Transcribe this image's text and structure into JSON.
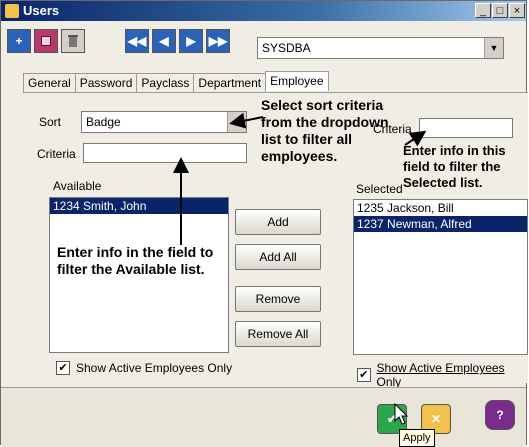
{
  "window": {
    "title": "Users",
    "minimize": "_",
    "maximize": "□",
    "close": "×"
  },
  "toolbar": {
    "database": "SYSDBA",
    "add_icon": "plus-icon",
    "save_icon": "save-icon",
    "delete_icon": "trash-icon",
    "first_icon": "first-record-icon",
    "prev_icon": "previous-record-icon",
    "next_icon": "next-record-icon",
    "last_icon": "last-record-icon"
  },
  "tabs": [
    "General",
    "Password",
    "Payclass",
    "Department",
    "Employee"
  ],
  "form": {
    "sort_label": "Sort",
    "sort_value": "Badge",
    "criteria_label": "Criteria",
    "criteria_value": "",
    "criteria_right_label": "Criteria",
    "available_label": "Available",
    "selected_label": "Selected",
    "available_items": [
      "1234 Smith, John"
    ],
    "selected_items": [
      "1235 Jackson, Bill",
      "1237 Newman, Alfred"
    ]
  },
  "buttons": {
    "add": "Add",
    "add_all": "Add All",
    "remove": "Remove",
    "remove_all": "Remove All",
    "tooltip": "Apply"
  },
  "checkboxes": {
    "left": "Show Active Employees Only",
    "right": "Show Active Employees Only"
  },
  "annotations": {
    "sort": "Select sort criteria from the dropdown list to filter all employees.",
    "available": "Enter info in the field to filter the Available list.",
    "selected": "Enter info in this field to filter the Selected list."
  },
  "colors": {
    "title_bar": "#0a246a",
    "selection": "#0a246a",
    "apply": "#2da44e",
    "cancel": "#f2c14b",
    "help": "#7a2c8c"
  }
}
